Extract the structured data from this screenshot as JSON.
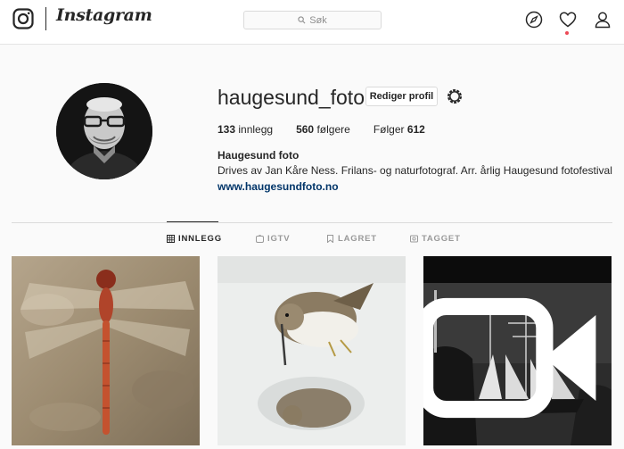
{
  "brand": {
    "wordmark": "Instagram"
  },
  "search": {
    "placeholder": "Søk"
  },
  "profile": {
    "username": "haugesund_foto",
    "edit_label": "Rediger profil",
    "stats": [
      {
        "count": "133",
        "label": "innlegg"
      },
      {
        "count": "560",
        "label": "følgere"
      },
      {
        "prefix": "Følger",
        "count": "612"
      }
    ],
    "full_name": "Haugesund foto",
    "bio": "Drives av Jan Kåre Ness. Frilans- og naturfotograf. Arr. årlig Haugesund fotofestival",
    "website": "www.haugesundfoto.no"
  },
  "tabs": [
    {
      "label": "INNLEGG",
      "icon": "grid-icon",
      "active": true
    },
    {
      "label": "IGTV",
      "icon": "igtv-icon",
      "active": false
    },
    {
      "label": "LAGRET",
      "icon": "bookmark-icon",
      "active": false
    },
    {
      "label": "TAGGET",
      "icon": "tag-icon",
      "active": false
    }
  ],
  "posts": [
    {
      "subject": "dragonfly",
      "video": false
    },
    {
      "subject": "sandpiper",
      "video": false
    },
    {
      "subject": "tall-ship",
      "video": true
    }
  ],
  "colors": {
    "link": "#003569",
    "notification": "#ed4956",
    "text": "#262626",
    "muted": "#999999"
  }
}
